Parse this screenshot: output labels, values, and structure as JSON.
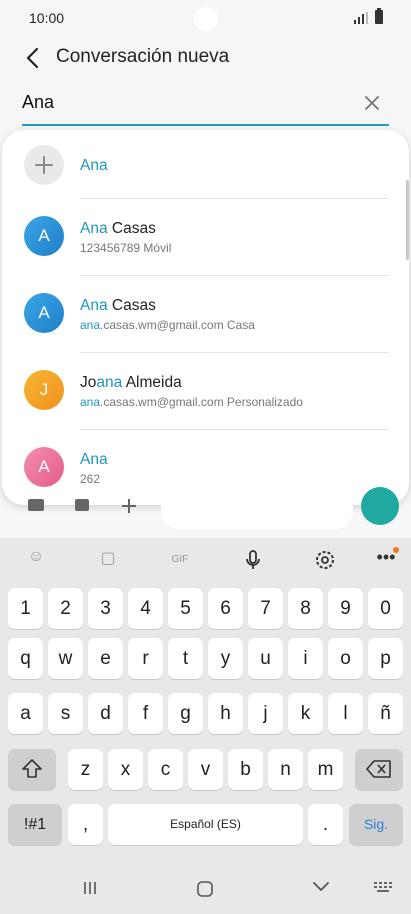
{
  "status": {
    "time": "10:00"
  },
  "header": {
    "title": "Conversación nueva"
  },
  "search": {
    "value": "Ana"
  },
  "suggestions": [
    {
      "name_hl": "Ana",
      "name_rest": "",
      "sub_hl": "",
      "sub_rest": "",
      "avatar": "+",
      "type": "add"
    },
    {
      "name_hl": "Ana",
      "name_rest": " Casas",
      "sub_hl": "",
      "sub_rest": "123456789  Móvil",
      "avatar": "A",
      "type": "blue"
    },
    {
      "name_hl": "Ana",
      "name_rest": " Casas",
      "sub_hl": "ana",
      "sub_rest": ".casas.wm@gmail.com  Casa",
      "avatar": "A",
      "type": "blue"
    },
    {
      "name_pre": "Jo",
      "name_hl": "ana",
      "name_rest": " Almeida",
      "sub_hl": "ana",
      "sub_rest": ".casas.wm@gmail.com  Personalizado",
      "avatar": "J",
      "type": "orange"
    },
    {
      "name_hl": "Ana",
      "name_rest": "",
      "sub_hl": "",
      "sub_rest": "262",
      "avatar": "A",
      "type": "pink"
    }
  ],
  "keyboard": {
    "row1": [
      "1",
      "2",
      "3",
      "4",
      "5",
      "6",
      "7",
      "8",
      "9",
      "0"
    ],
    "row2": [
      "q",
      "w",
      "e",
      "r",
      "t",
      "y",
      "u",
      "i",
      "o",
      "p"
    ],
    "row3": [
      "a",
      "s",
      "d",
      "f",
      "g",
      "h",
      "j",
      "k",
      "l",
      "ñ"
    ],
    "row4": [
      "z",
      "x",
      "c",
      "v",
      "b",
      "n",
      "m"
    ],
    "sym": "!#1",
    "comma": ",",
    "space": "Español (ES)",
    "period": ".",
    "go": "Sig."
  }
}
